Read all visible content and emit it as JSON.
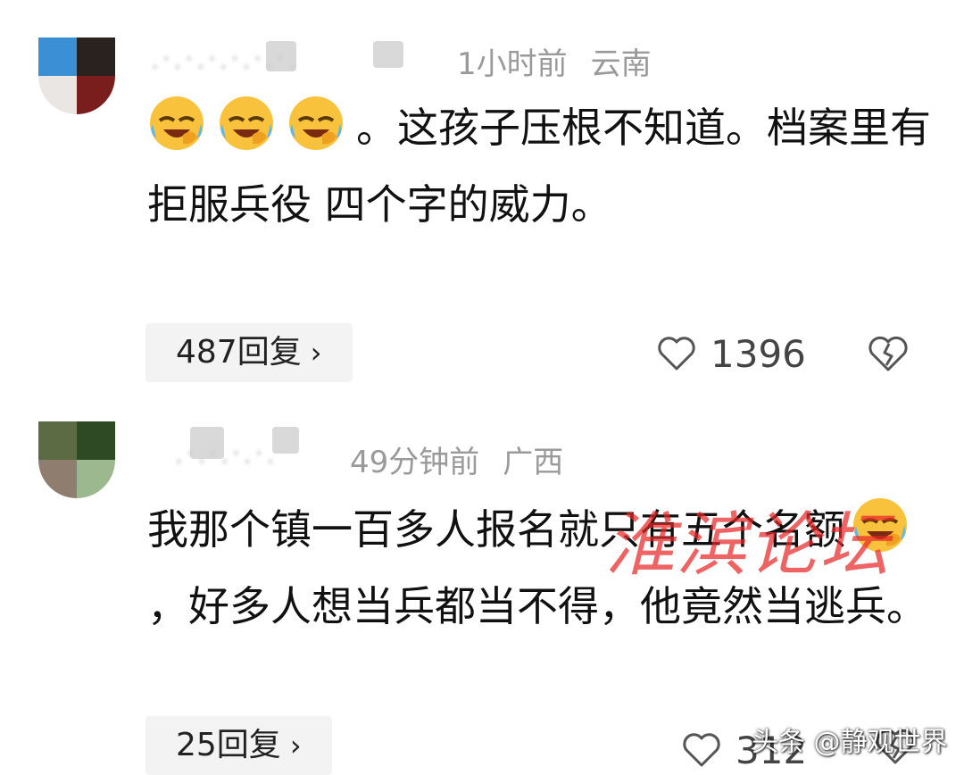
{
  "comments": [
    {
      "time": "1小时前",
      "location": "云南",
      "text": "。这孩子压根不知道。档案里有 拒服兵役 四个字的威力。",
      "emoji_count": 3,
      "reply_label": "487回复",
      "like_count": "1396"
    },
    {
      "time": "49分钟前",
      "location": "广西",
      "text_before_emoji": "我那个镇一百多人报名就只有五个名额",
      "text_after_emoji": "，好多人想当兵都当不得，他竟然当逃兵。",
      "reply_label": "25回复",
      "like_count": "312"
    }
  ],
  "icons": {
    "emoji": "laughing-crying-emoji",
    "reply_chevron": "chevron-right-icon",
    "like": "heart-outline-icon",
    "dislike": "broken-heart-icon"
  },
  "watermark": "淮滨论坛",
  "credit": "头条 @静观世界",
  "colors": {
    "text": "#111111",
    "meta": "#9a9a9a",
    "reply_bg": "#f3f3f3",
    "watermark": "#e82828"
  }
}
